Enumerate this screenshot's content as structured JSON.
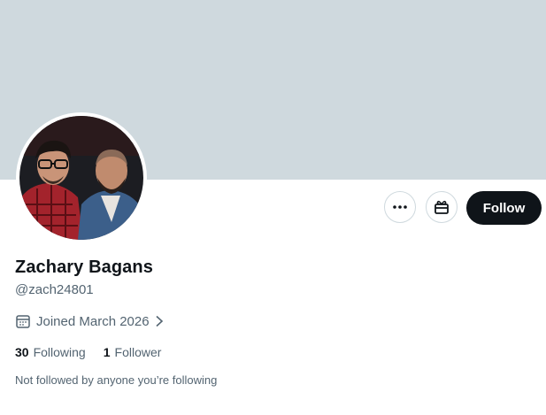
{
  "profile": {
    "display_name": "Zachary Bagans",
    "handle": "@zach24801",
    "joined": "Joined March 2026",
    "following_count": "30",
    "following_label": "Following",
    "followers_count": "1",
    "followers_label": "Follower",
    "not_followed_text": "Not followed by anyone you’re following"
  },
  "actions": {
    "follow_label": "Follow",
    "more_icon": "more-horizontal-icon",
    "gift_icon": "gift-icon"
  },
  "colors": {
    "banner": "#cfd9de",
    "primary_text": "#0f1419",
    "secondary_text": "#536471",
    "follow_button": "#0f1419"
  }
}
